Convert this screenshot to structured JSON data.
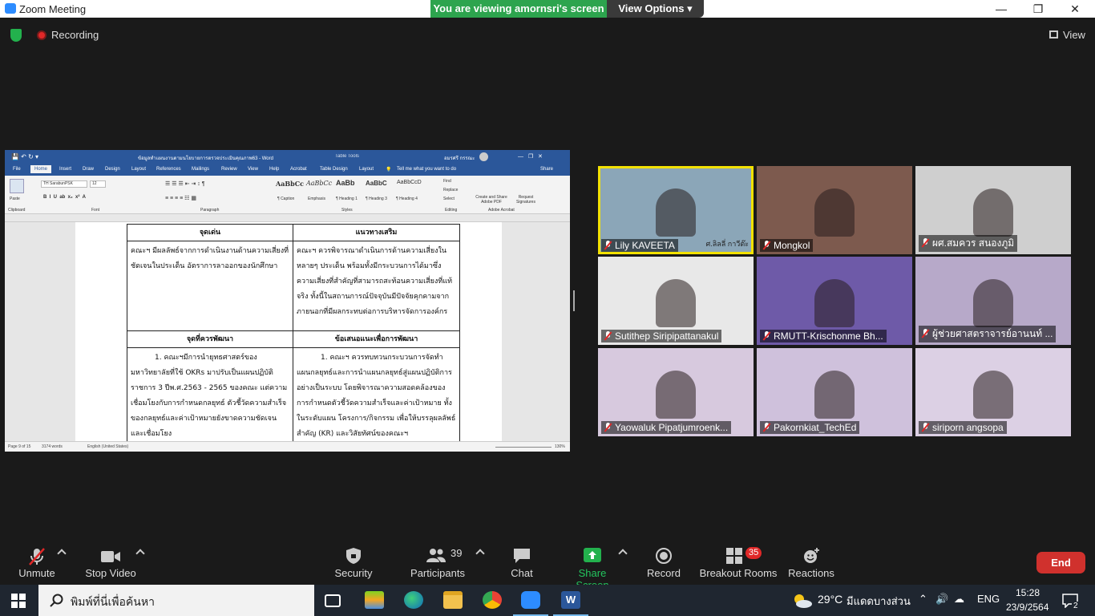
{
  "window": {
    "title": "Zoom Meeting",
    "share_banner": "You are viewing amornsri's screen",
    "view_options": "View Options",
    "min": "—",
    "max": "❐",
    "close": "✕"
  },
  "status": {
    "recording": "Recording",
    "view": "View"
  },
  "word": {
    "title": "ข้อมูลทำแผนงานตามนโยบายการตรวจประเมินคุณภาพ63 - Word",
    "table_tools": "Table Tools",
    "user": "อมรศรี กรรณะ",
    "tabs": [
      "File",
      "Home",
      "Insert",
      "Draw",
      "Design",
      "Layout",
      "References",
      "Mailings",
      "Review",
      "View",
      "Help",
      "Acrobat",
      "Table Design",
      "Layout"
    ],
    "tell_me": "Tell me what you want to do",
    "share": "Share",
    "font_name": "TH SarabunPSK",
    "font_size": "12",
    "styles": [
      "AaBbCc",
      "AaBbCc",
      "AaBb",
      "AaBbC",
      "AaBbCcD"
    ],
    "style_names": [
      "¶ Caption",
      "Emphasis",
      "¶ Heading 1",
      "¶ Heading 3",
      "¶ Heading 4"
    ],
    "groups": [
      "Clipboard",
      "Font",
      "Paragraph",
      "Styles",
      "Editing",
      "Adobe Acrobat"
    ],
    "editing": [
      "Find",
      "Replace",
      "Select"
    ],
    "acrobat": [
      "Create and Share Adobe PDF",
      "Request Signatures"
    ],
    "paste": "Paste",
    "status_page": "Page 9 of 15",
    "status_words": "3174 words",
    "status_lang": "English (United States)",
    "status_zoom": "130%",
    "table": {
      "h1": "จุดเด่น",
      "h2": "แนวทางเสริม",
      "r1c1": "คณะฯ มีผลลัพธ์จากการดำเนินงานด้านความเสี่ยงที่ชัดเจนในประเด็น อัตราการลาออกของนักศึกษา",
      "r1c2": "คณะฯ ควรพิจารณาดำเนินการด้านความเสี่ยงในหลายๆ ประเด็น พร้อมทั้งมีกระบวนการได้มาซึ่งความเสี่ยงที่สำคัญที่สามารถสะท้อนความเสี่ยงที่แท้จริง ทั้งนี้ในสถานการณ์ปัจจุบันมีปัจจัยคุกคามจากภายนอกที่มีผลกระทบต่อการบริหารจัดการองค์กร",
      "h3": "จุดที่ควรพัฒนา",
      "h4": "ข้อเสนอแนะเพื่อการพัฒนา",
      "r2c1": "1. คณะฯมีการนำยุทธศาสตร์ของมหาวิทยาลัยที่ใช้ OKRs มาปรับเป็นแผนปฏิบัติราชการ 3 ปีพ.ศ.2563 - 2565 ของคณะ แต่ความเชื่อมโยงกับการกำหนดกลยุทธ์ ตัวชี้วัดความสำเร็จของกลยุทธ์และค่าเป้าหมายยังขาดความชัดเจน และเชื่อมโยง",
      "r2c2": "1. คณะฯ ควรทบทวนกระบวนการจัดทำแผนกลยุทธ์และการนำแผนกลยุทธ์สู่แผนปฏิบัติการอย่างเป็นระบบ โดยพิจารณาความสอดคล้องของการกำหนดตัวชี้วัดความสำเร็จและค่าเป้าหมาย ทั้งในระดับแผน โครงการ/กิจกรรม เพื่อให้บรรลุผลลัพธ์สำคัญ (KR) และวิสัยทัศน์ของคณะฯ"
    }
  },
  "participants_tiles": [
    {
      "name": "Lily KAVEETA",
      "caption": "ศ.ลิลลี่ กาวีต๊ะ",
      "bg": "#8ba6b8"
    },
    {
      "name": "Mongkol",
      "bg": "#7d5a4e"
    },
    {
      "name": "ผศ.สมควร สนองภูมิ",
      "bg": "#cfcfcf"
    },
    {
      "name": "Sutithep Siripipattanakul",
      "bg": "#e8e8e8"
    },
    {
      "name": "RMUTT-Krischonme Bh...",
      "bg": "#6e5aa8"
    },
    {
      "name": "ผู้ช่วยศาสตราจารย์อานนท์ ...",
      "bg": "#b7a9c9"
    },
    {
      "name": "Yaowaluk Pipatjumroenk...",
      "bg": "#d7c9de"
    },
    {
      "name": "Pakornkiat_TechEd",
      "bg": "#cfc1dc"
    },
    {
      "name": "siriporn angsopa",
      "bg": "#dcd0e4"
    }
  ],
  "toolbar": {
    "unmute": "Unmute",
    "stop_video": "Stop Video",
    "security": "Security",
    "participants": "Participants",
    "participants_count": "39",
    "chat": "Chat",
    "share_screen": "Share Screen",
    "record": "Record",
    "breakout": "Breakout Rooms",
    "breakout_count": "35",
    "reactions": "Reactions",
    "end": "End"
  },
  "taskbar": {
    "search_placeholder": "พิมพ์ที่นี่เพื่อค้นหา",
    "weather_temp": "29°C",
    "weather_text": "มีแดดบางส่วน",
    "lang": "ENG",
    "time": "15:28",
    "date": "23/9/2564",
    "notif_count": "2"
  },
  "colors": {
    "zoom_blue": "#2d8cff",
    "share_green": "#2da44e",
    "end_red": "#d0312d",
    "word_blue": "#2b579a",
    "active_speaker": "#f2e100"
  }
}
